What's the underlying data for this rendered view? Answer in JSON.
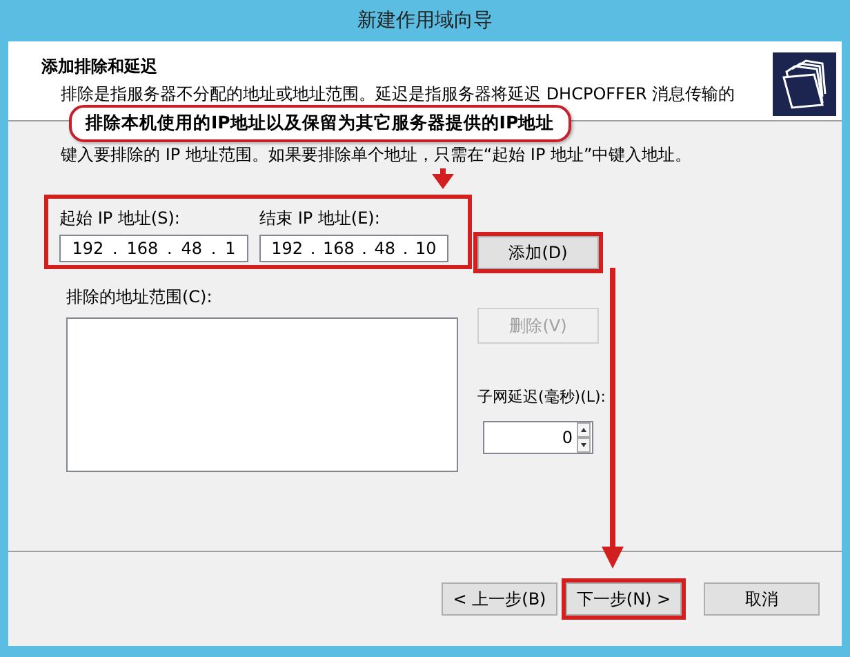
{
  "window": {
    "title": "新建作用域向导"
  },
  "header": {
    "title": "添加排除和延迟",
    "description": "排除是指服务器不分配的地址或地址范围。延迟是指服务器将延迟 DHCPOFFER 消息传输的"
  },
  "annotation": {
    "text": "排除本机使用的IP地址以及保留为其它服务器提供的IP地址"
  },
  "instruction": "键入要排除的 IP 地址范围。如果要排除单个地址，只需在“起始 IP 地址”中键入地址。",
  "ip_range": {
    "highlighted": true,
    "separator": ".",
    "start": {
      "label": "起始 IP 地址(S):",
      "octets": [
        "192",
        "168",
        "48",
        "1"
      ]
    },
    "end": {
      "label": "结束 IP 地址(E):",
      "octets": [
        "192",
        "168",
        "48",
        "10"
      ]
    }
  },
  "add_button": {
    "label": "添加(D)",
    "disabled": false,
    "highlighted": true
  },
  "excluded_list": {
    "label": "排除的地址范围(C):"
  },
  "delete_button": {
    "label": "删除(V)",
    "disabled": true,
    "highlighted": false
  },
  "delay": {
    "label": "子网延迟(毫秒)(L):",
    "value": "0"
  },
  "buttons": [
    {
      "label": "< 上一步(B)",
      "highlighted": false
    },
    {
      "label": "下一步(N) >",
      "highlighted": true
    },
    {
      "label": "取消",
      "highlighted": false
    }
  ]
}
